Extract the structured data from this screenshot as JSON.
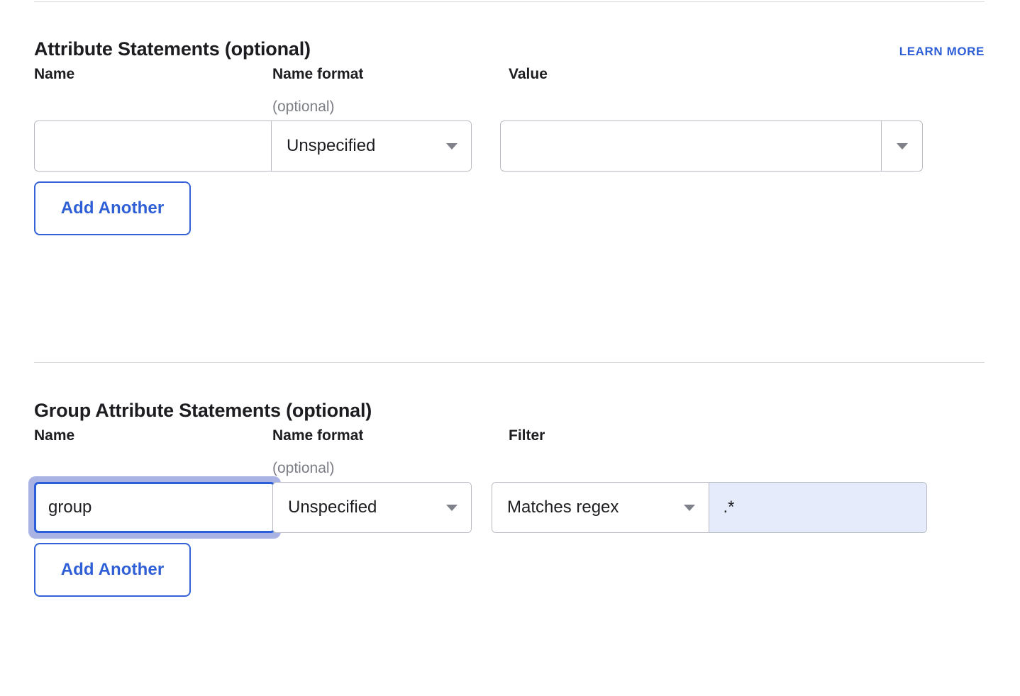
{
  "dividers": {
    "top": true,
    "middle": true
  },
  "colors": {
    "accent_blue": "#2f5fd7",
    "button_border_blue": "#3362d6",
    "focus_border": "#2b5fd9",
    "focus_ring": "#aab4e4",
    "field_border": "#b9bcc2",
    "divider": "#d7d9dd",
    "muted_text": "#7b7e85",
    "highlight_fill": "#e5ebfa",
    "text": "#1d1d21",
    "caret_gray": "#7e8189"
  },
  "attribute_statements": {
    "title": "Attribute Statements (optional)",
    "learn_more_label": "LEARN MORE",
    "columns": {
      "name": "Name",
      "name_format": "Name format",
      "name_format_sub": "(optional)",
      "value": "Value"
    },
    "row": {
      "name_value": "",
      "name_placeholder": "",
      "name_format_value": "Unspecified",
      "value_value": "",
      "value_placeholder": ""
    },
    "add_another_label": "Add Another"
  },
  "group_attribute_statements": {
    "title": "Group Attribute Statements (optional)",
    "columns": {
      "name": "Name",
      "name_format": "Name format",
      "name_format_sub": "(optional)",
      "filter": "Filter"
    },
    "row": {
      "name_value": "group",
      "name_placeholder": "",
      "name_focused": true,
      "name_format_value": "Unspecified",
      "filter_type_value": "Matches regex",
      "filter_value": ".*",
      "filter_placeholder": ""
    },
    "add_another_label": "Add Another"
  },
  "icons": {
    "caret_down": "chevron-down-icon"
  }
}
